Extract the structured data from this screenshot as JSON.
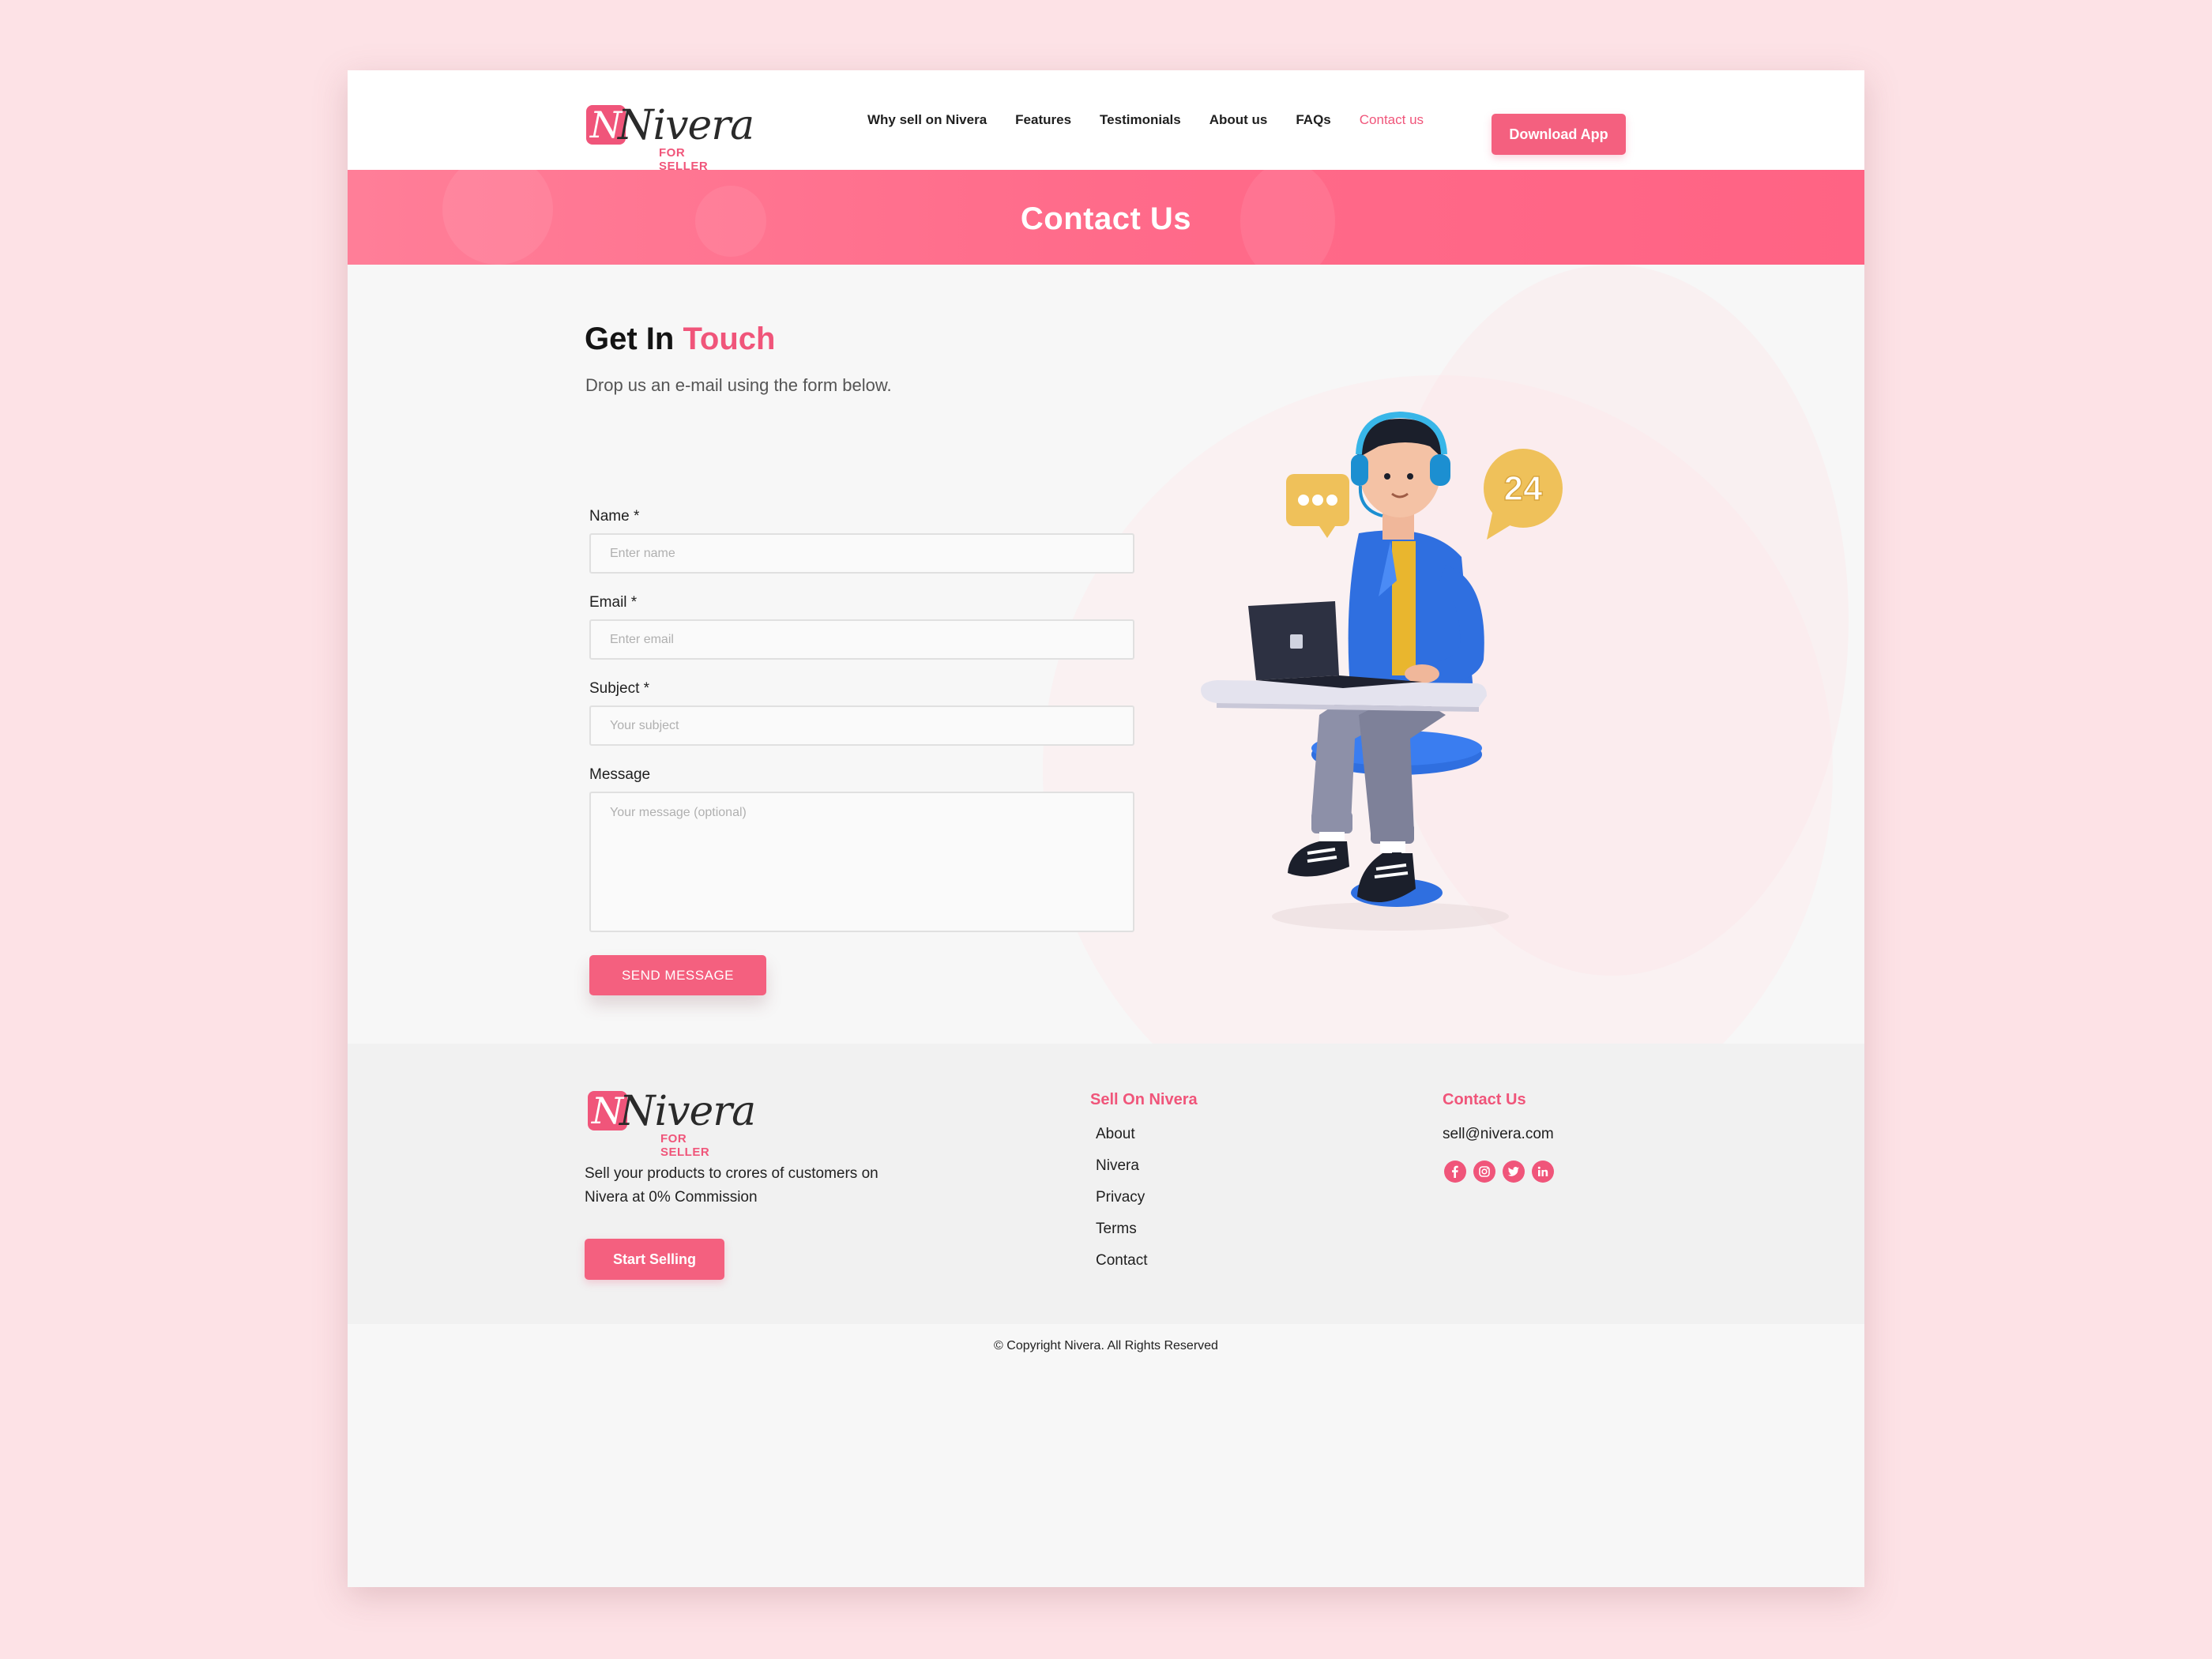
{
  "brand": {
    "name": "Nivera",
    "sub": "FOR SELLER",
    "accent": "#f0557a"
  },
  "nav": {
    "items": [
      "Why sell on Nivera",
      "Features",
      "Testimonials",
      "About us",
      "FAQs",
      "Contact us"
    ],
    "active": "Contact us",
    "download_label": "Download App"
  },
  "banner": {
    "title": "Contact Us"
  },
  "contact": {
    "heading_plain": "Get In",
    "heading_accent": "Touch",
    "intro": "Drop us an e-mail using the form below.",
    "fields": {
      "name": {
        "label": "Name *",
        "placeholder": "Enter name",
        "value": ""
      },
      "email": {
        "label": "Email *",
        "placeholder": "Enter email",
        "value": ""
      },
      "subject": {
        "label": "Subject *",
        "placeholder": "Your subject",
        "value": ""
      },
      "message": {
        "label": "Message",
        "placeholder": "Your message (optional)",
        "value": ""
      }
    },
    "send_label": "SEND MESSAGE",
    "illustration": {
      "badge": "24"
    }
  },
  "footer": {
    "tagline": "Sell your products to crores of customers on Nivera at 0% Commission",
    "start_label": "Start Selling",
    "sell_heading": "Sell On Nivera",
    "links": [
      "About",
      "Nivera",
      "Privacy",
      "Terms",
      "Contact"
    ],
    "contact_heading": "Contact Us",
    "email": "sell@nivera.com",
    "social": [
      "facebook-icon",
      "instagram-icon",
      "twitter-icon",
      "linkedin-icon"
    ],
    "copyright": "© Copyright Nivera. All Rights Reserved"
  }
}
